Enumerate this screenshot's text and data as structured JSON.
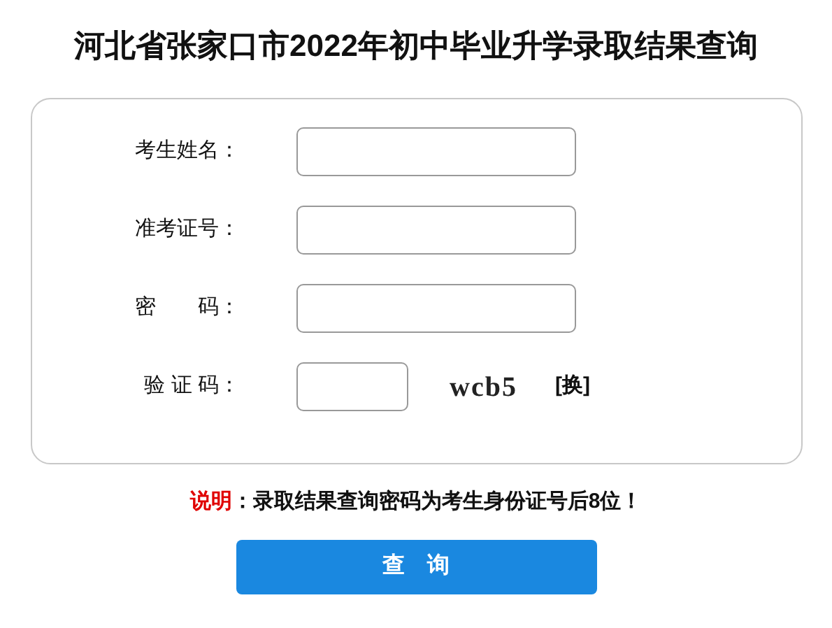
{
  "title": "河北省张家口市2022年初中毕业升学录取结果查询",
  "fields": [
    {
      "label": "考生姓名：",
      "kind": "text"
    },
    {
      "label": "准考证号：",
      "kind": "text"
    },
    {
      "label": "密　　码：",
      "kind": "text"
    },
    {
      "label": "验 证 码：",
      "kind": "captcha",
      "captcha": "wcb5",
      "refresh": "[换]"
    }
  ],
  "note": {
    "label": "说明",
    "text": "：录取结果查询密码为考生身份证号后8位！"
  },
  "button": "查　询"
}
